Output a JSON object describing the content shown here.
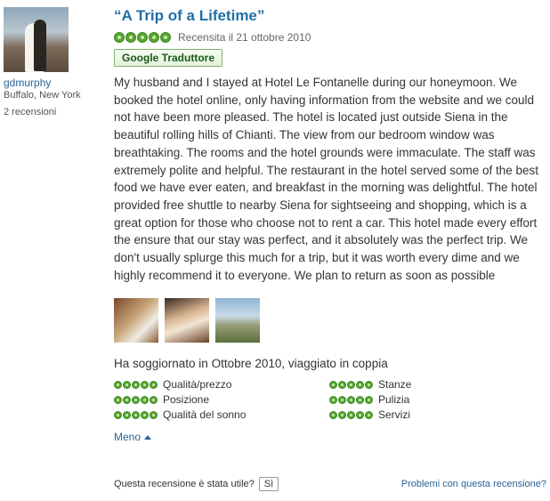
{
  "reviewer": {
    "username": "gdmurphy",
    "location": "Buffalo, New York",
    "review_count": "2 recensioni"
  },
  "review": {
    "title": "“A Trip of a Lifetime”",
    "rating": 5,
    "date": "Recensita il 21 ottobre 2010",
    "translate_label": "Google Traduttore",
    "text": "My husband and I stayed at Hotel Le Fontanelle during our honeymoon. We booked the hotel online, only having information from the website and we could not have been more pleased. The hotel is located just outside Siena in the beautiful rolling hills of Chianti. The view from our bedroom window was breathtaking. The rooms and the hotel grounds were immaculate. The staff was extremely polite and helpful. The restaurant in the hotel served some of the best food we have ever eaten, and breakfast in the morning was delightful. The hotel provided free shuttle to nearby Siena for sightseeing and shopping, which is a great option for those who choose not to rent a car. This hotel made every effort the ensure that our stay was perfect, and it absolutely was the perfect trip. We don't usually splurge this much for a trip, but it was worth every dime and we highly recommend it to everyone. We plan to return as soon as possible",
    "stay_info": "Ha soggiornato in Ottobre 2010, viaggiato in coppia",
    "sub_ratings": [
      {
        "label": "Qualità/prezzo",
        "rating": 5
      },
      {
        "label": "Stanze",
        "rating": 5
      },
      {
        "label": "Posizione",
        "rating": 5
      },
      {
        "label": "Pulizia",
        "rating": 5
      },
      {
        "label": "Qualità del sonno",
        "rating": 5
      },
      {
        "label": "Servizi",
        "rating": 5
      }
    ],
    "less_label": "Meno"
  },
  "footer": {
    "helpful_question": "Questa recensione è stata utile?",
    "yes_label": "Sì",
    "problems_link": "Problemi con questa recensione?"
  },
  "colors": {
    "title": "#1f6fa8",
    "bubble": "#58a52f",
    "link": "#2a6496"
  }
}
